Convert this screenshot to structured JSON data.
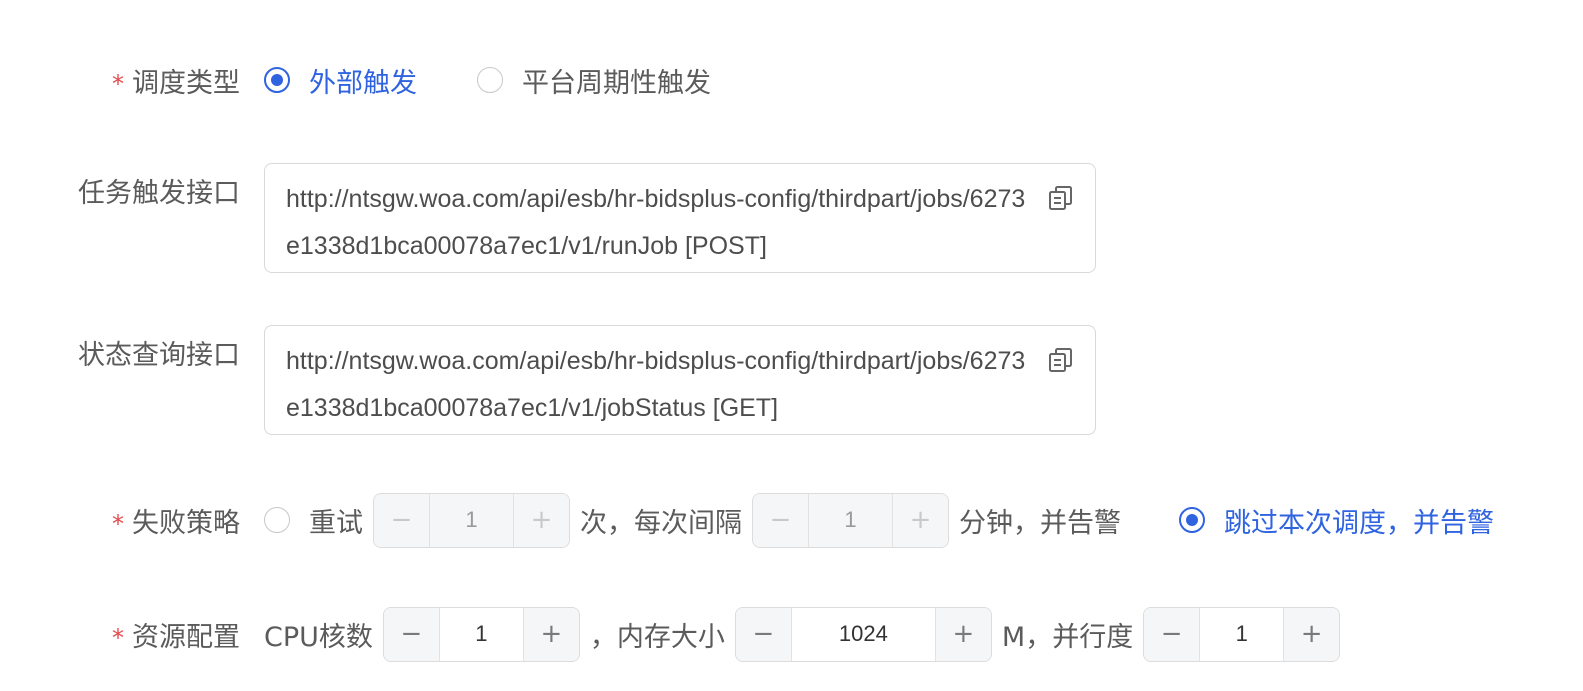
{
  "schedule_type": {
    "label": "调度类型",
    "required_mark": "*",
    "options": [
      {
        "label": "外部触发",
        "checked": true
      },
      {
        "label": "平台周期性触发",
        "checked": false
      }
    ]
  },
  "trigger_api": {
    "label": "任务触发接口",
    "value": "http://ntsgw.woa.com/api/esb/hr-bidsplus-config/thirdpart/jobs/6273e1338d1bca00078a7ec1/v1/runJob [POST]",
    "copy_icon": "copy-icon"
  },
  "status_api": {
    "label": "状态查询接口",
    "value": "http://ntsgw.woa.com/api/esb/hr-bidsplus-config/thirdpart/jobs/6273e1338d1bca00078a7ec1/v1/jobStatus [GET]",
    "copy_icon": "copy-icon"
  },
  "failure_policy": {
    "label": "失败策略",
    "required_mark": "*",
    "retry_label": "重试",
    "retry_count": "1",
    "times_text": "次，每次间隔",
    "interval": "1",
    "minutes_text": "分钟，并告警",
    "skip_label": "跳过本次调度，并告警",
    "retry_checked": false,
    "skip_checked": true
  },
  "resource_config": {
    "label": "资源配置",
    "required_mark": "*",
    "cpu_label": "CPU核数",
    "cpu": "1",
    "mem_label": "，内存大小",
    "memory": "1024",
    "mem_unit_text": "M，并行度",
    "parallelism": "1"
  },
  "stepper": {
    "minus": "−",
    "plus": "+"
  },
  "colors": {
    "accent": "#2f63e0",
    "required": "#e5484d",
    "border": "#d9d9d9",
    "disabled_bg": "#f5f6f7"
  }
}
